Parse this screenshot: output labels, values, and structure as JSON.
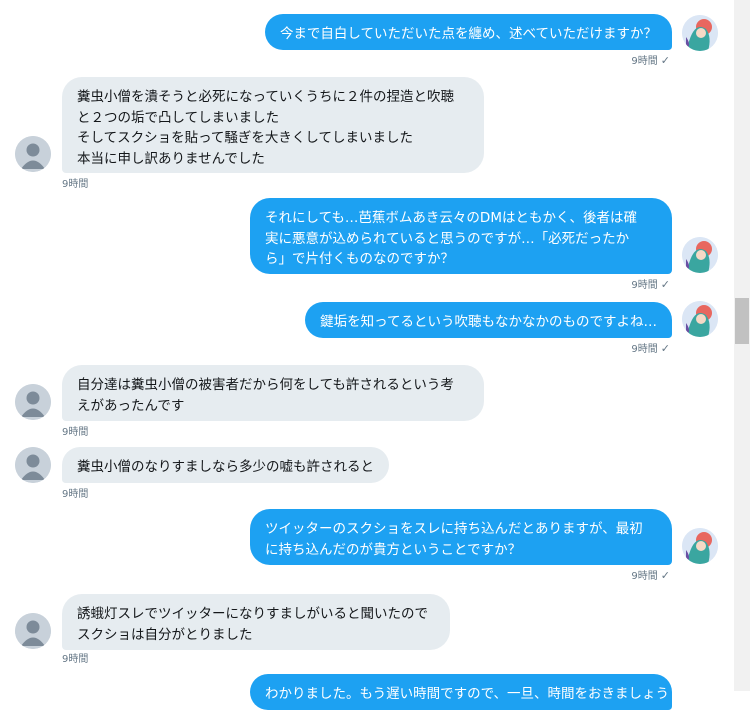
{
  "messages": [
    {
      "text": "今まで自白していただいた点を纏め、述べていただけますか？",
      "time": "9時間"
    },
    {
      "text": "糞虫小僧を潰そうと必死になっていくうちに２件の捏造と吹聴\nと２つの垢で凸してしまいました\nそしてスクショを貼って騒ぎを大きくしてしまいました\n本当に申し訳ありませんでした",
      "time": "9時間"
    },
    {
      "text": "それにしても…芭蕉ボムあき云々のDMはともかく、後者は確\n実に悪意が込められていると思うのですが…「必死だったか\nら」で片付くものなのですか？",
      "time": "9時間"
    },
    {
      "text": "鍵垢を知ってるという吹聴もなかなかのものですよね…",
      "time": "9時間"
    },
    {
      "text": "自分達は糞虫小僧の被害者だから何をしても許されるという考\nえがあったんです",
      "time": "9時間"
    },
    {
      "text": "糞虫小僧のなりすましなら多少の嘘も許されると",
      "time": "9時間"
    },
    {
      "text": "ツイッターのスクショをスレに持ち込んだとありますが、最初\nに持ち込んだのが貴方ということですか？",
      "time": "9時間"
    },
    {
      "text": "誘蛾灯スレでツイッターになりすましがいると聞いたので\nスクショは自分がとりました",
      "time": "9時間"
    },
    {
      "text": "わかりました。もう遅い時間ですので、一旦、時間をおきましょう",
      "time": ""
    }
  ],
  "read_mark": "✓",
  "icons": {
    "me": "user-avatar-icon",
    "other": "default-avatar-icon",
    "check": "read-check-icon"
  },
  "colors": {
    "outgoing": "#1da1f2",
    "incoming": "#e6ecf0",
    "meta": "#657786"
  }
}
